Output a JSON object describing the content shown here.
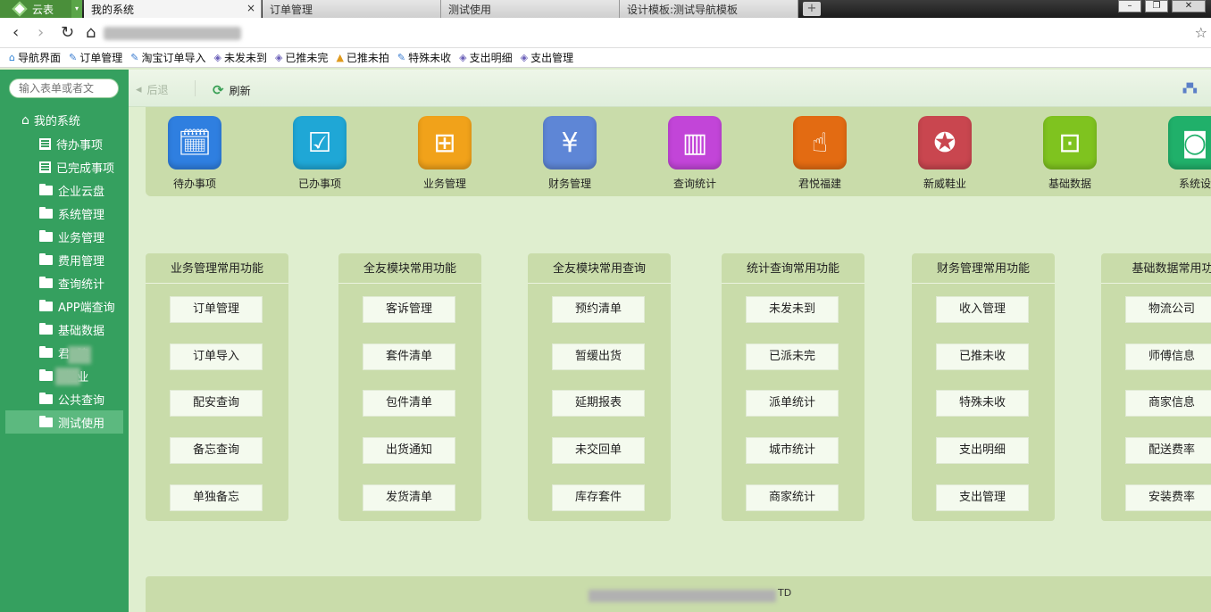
{
  "browser": {
    "app_name": "云表",
    "tabs": [
      {
        "label": "我的系统",
        "active": true,
        "close": "×"
      },
      {
        "label": "订单管理",
        "active": false
      },
      {
        "label": "测试使用",
        "active": false
      },
      {
        "label": "设计模板:测试导航模板",
        "active": false
      }
    ],
    "newtab": "+",
    "window_controls": [
      "–",
      "❐",
      "✕"
    ],
    "nav": {
      "back": "‹",
      "forward": "›",
      "reload": "↻",
      "home": "⌂",
      "star": "☆"
    }
  },
  "bookmarks": [
    {
      "label": "导航界面",
      "icon": "home-icon",
      "glyph": "⌂",
      "color": "#2a7fd4"
    },
    {
      "label": "订单管理",
      "icon": "wrench-icon",
      "glyph": "✎",
      "color": "#3a7cd0"
    },
    {
      "label": "淘宝订单导入",
      "icon": "wrench-icon",
      "glyph": "✎",
      "color": "#3a7cd0"
    },
    {
      "label": "未发未到",
      "icon": "tag-icon",
      "glyph": "◈",
      "color": "#6a5fb8"
    },
    {
      "label": "已推未完",
      "icon": "tag-icon",
      "glyph": "◈",
      "color": "#6a5fb8"
    },
    {
      "label": "已推未拍",
      "icon": "warning-icon",
      "glyph": "▲",
      "color": "#e09a1e"
    },
    {
      "label": "特殊未收",
      "icon": "wrench-icon",
      "glyph": "✎",
      "color": "#3a7cd0"
    },
    {
      "label": "支出明细",
      "icon": "tag-icon",
      "glyph": "◈",
      "color": "#6a5fb8"
    },
    {
      "label": "支出管理",
      "icon": "tag-icon",
      "glyph": "◈",
      "color": "#6a5fb8"
    }
  ],
  "sidebar": {
    "search_placeholder": "输入表单或者文",
    "root_label": "我的系统",
    "items": [
      {
        "label": "待办事项",
        "icon": "doc"
      },
      {
        "label": "已完成事项",
        "icon": "doc"
      },
      {
        "label": "企业云盘",
        "icon": "folder"
      },
      {
        "label": "系统管理",
        "icon": "folder"
      },
      {
        "label": "业务管理",
        "icon": "folder"
      },
      {
        "label": "费用管理",
        "icon": "folder"
      },
      {
        "label": "查询统计",
        "icon": "folder"
      },
      {
        "label": "APP端查询",
        "icon": "folder"
      },
      {
        "label": "基础数据",
        "icon": "folder"
      },
      {
        "label": "君  建",
        "icon": "folder"
      },
      {
        "label": "  鞋业",
        "icon": "folder"
      },
      {
        "label": "公共查询",
        "icon": "folder"
      },
      {
        "label": "测试使用",
        "icon": "folder",
        "selected": true
      }
    ]
  },
  "toolbar": {
    "back_label": "后退",
    "refresh_label": "刷新"
  },
  "apps": [
    {
      "label": "待办事项",
      "color": "#2f7fe0",
      "icon": "calendar-clock-icon"
    },
    {
      "label": "已办事项",
      "color": "#1fa7d6",
      "icon": "checklist-icon"
    },
    {
      "label": "业务管理",
      "color": "#f1a21a",
      "icon": "org-chart-icon"
    },
    {
      "label": "财务管理",
      "color": "#5e86d6",
      "icon": "yuan-wallet-icon"
    },
    {
      "label": "查询统计",
      "color": "#c245d8",
      "icon": "building-icon"
    },
    {
      "label": "君悦福建",
      "color": "#e36b12",
      "icon": "touch-icon"
    },
    {
      "label": "新威鞋业",
      "color": "#c9464f",
      "icon": "certificate-icon"
    },
    {
      "label": "基础数据",
      "color": "#7fc31f",
      "icon": "toolbox-icon"
    },
    {
      "label": "系统设",
      "color": "#20b06a",
      "icon": "safe-icon"
    }
  ],
  "cards": [
    {
      "title": "业务管理常用功能",
      "buttons": [
        "订单管理",
        "订单导入",
        "配安查询",
        "备忘查询",
        "单独备忘"
      ]
    },
    {
      "title": "全友模块常用功能",
      "buttons": [
        "客诉管理",
        "套件清单",
        "包件清单",
        "出货通知",
        "发货清单"
      ]
    },
    {
      "title": "全友模块常用查询",
      "buttons": [
        "预约清单",
        "暂缓出货",
        "延期报表",
        "未交回单",
        "库存套件"
      ]
    },
    {
      "title": "统计查询常用功能",
      "buttons": [
        "未发未到",
        "已派未完",
        "派单统计",
        "城市统计",
        "商家统计"
      ]
    },
    {
      "title": "财务管理常用功能",
      "buttons": [
        "收入管理",
        "已推未收",
        "特殊未收",
        "支出明细",
        "支出管理"
      ]
    },
    {
      "title": "基础数据常用功",
      "buttons": [
        "物流公司",
        "师傅信息",
        "商家信息",
        "配送费率",
        "安装费率"
      ]
    }
  ],
  "footer": {
    "text": "TD"
  }
}
